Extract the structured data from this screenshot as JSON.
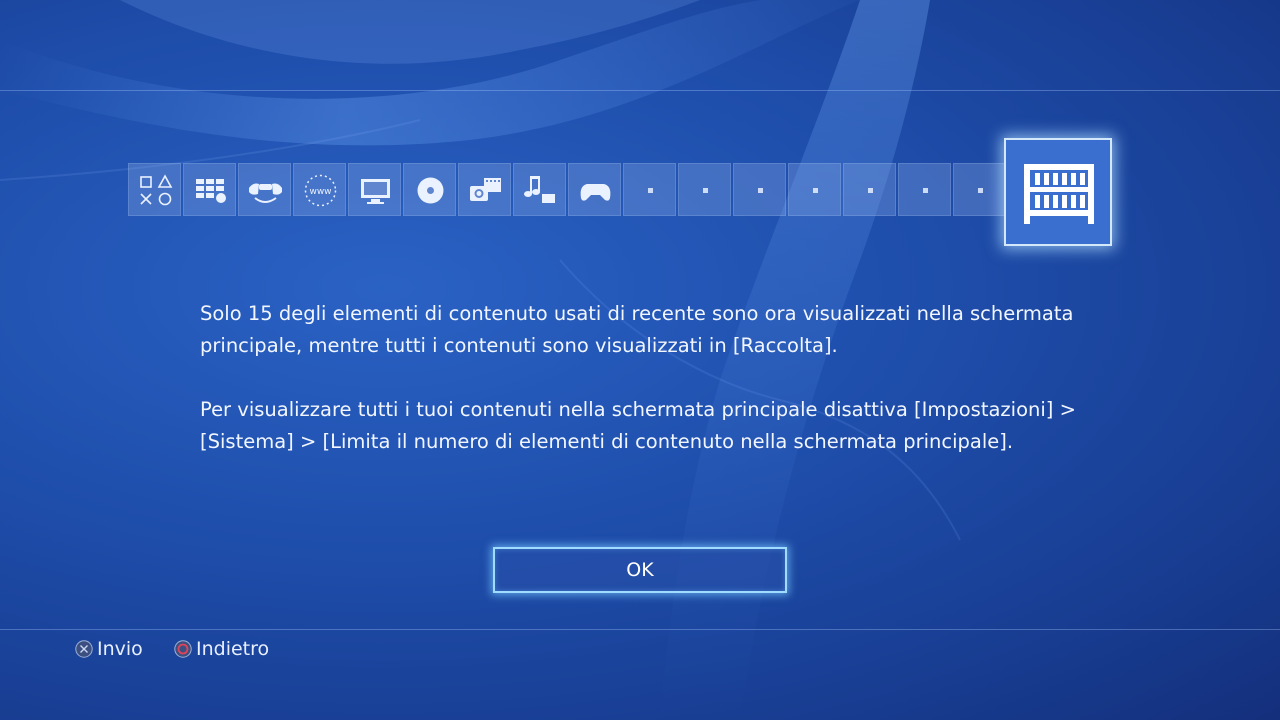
{
  "colors": {
    "background": "#1f4fad",
    "tile": "#5f86cf",
    "library_tile": "#3a6fd0",
    "button_glow": "#9fdcff",
    "text": "#f2f6ff"
  },
  "content_bar": {
    "tiles": [
      {
        "name": "ps-store-icon"
      },
      {
        "name": "tv-video-apps-icon"
      },
      {
        "name": "party-icon"
      },
      {
        "name": "internet-browser-icon"
      },
      {
        "name": "tv-icon"
      },
      {
        "name": "disc-icon"
      },
      {
        "name": "capture-gallery-icon"
      },
      {
        "name": "music-unlimited-icon"
      },
      {
        "name": "game-controller-icon"
      },
      {
        "name": "empty-slot"
      },
      {
        "name": "empty-slot"
      },
      {
        "name": "empty-slot"
      },
      {
        "name": "empty-slot"
      },
      {
        "name": "empty-slot"
      },
      {
        "name": "empty-slot"
      },
      {
        "name": "empty-slot"
      }
    ],
    "selected": {
      "name": "library-icon"
    }
  },
  "message": {
    "paragraph1": "Solo 15 degli elementi di contenuto usati di recente sono ora visualizzati nella schermata principale, mentre tutti i contenuti sono visualizzati in [Raccolta].",
    "paragraph2": "Per visualizzare tutti i tuoi contenuti nella schermata principale disattiva [Impostazioni] > [Sistema] > [Limita il numero di elementi di contenuto nella schermata principale]."
  },
  "ok_button": {
    "label": "OK"
  },
  "hints": {
    "enter_label": "Invio",
    "back_label": "Indietro"
  }
}
